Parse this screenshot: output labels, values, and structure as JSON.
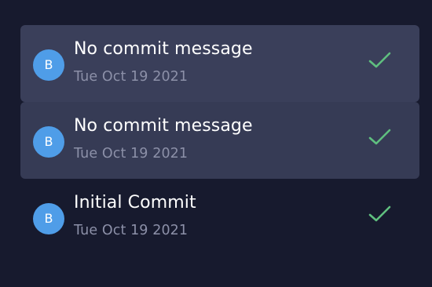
{
  "commits": [
    {
      "avatar_initial": "B",
      "message": "No commit message",
      "date": "Tue Oct 19 2021",
      "status_icon": "check-icon",
      "state": "hovered"
    },
    {
      "avatar_initial": "B",
      "message": "No commit message",
      "date": "Tue Oct 19 2021",
      "status_icon": "check-icon",
      "state": "selected"
    },
    {
      "avatar_initial": "B",
      "message": "Initial Commit",
      "date": "Tue Oct 19 2021",
      "status_icon": "check-icon",
      "state": "default"
    }
  ],
  "colors": {
    "background": "#171a2e",
    "row_highlight": "#3a3f5a",
    "avatar": "#4f9de8",
    "check": "#5fbf7f",
    "date_text": "#8c90a8"
  }
}
